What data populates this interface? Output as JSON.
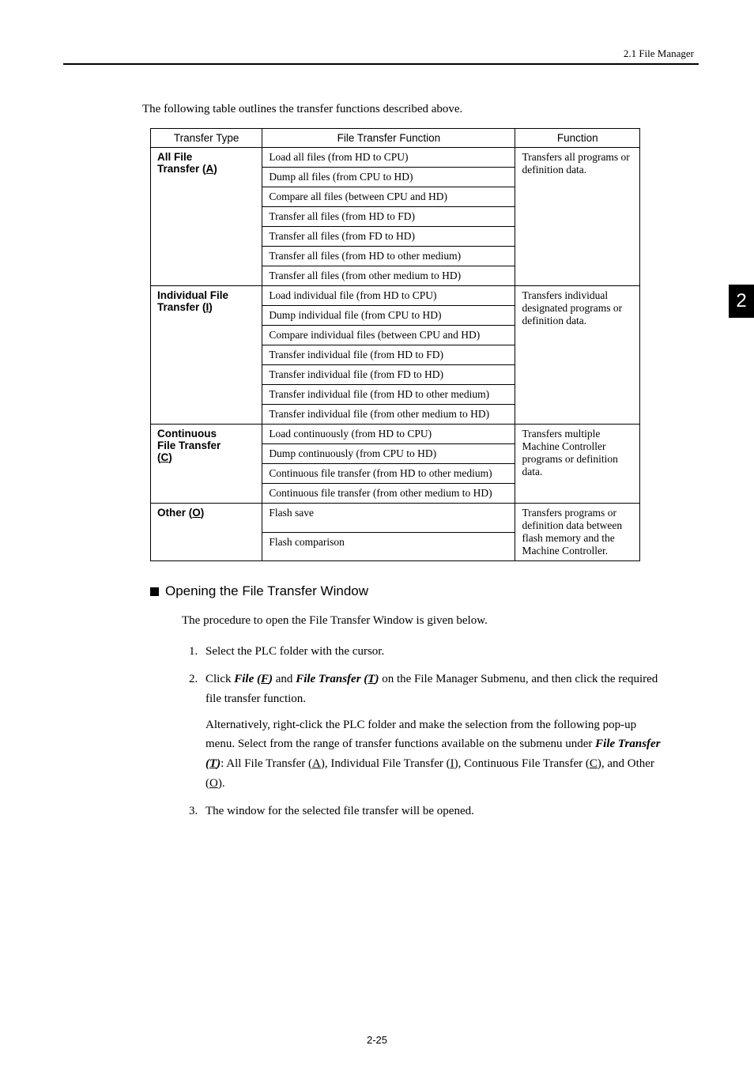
{
  "header": {
    "right_label": "2.1  File Manager"
  },
  "side_tab": "2",
  "intro": "The following table outlines the transfer functions described above.",
  "table": {
    "headers": [
      "Transfer Type",
      "File Transfer Function",
      "Function"
    ],
    "groups": [
      {
        "type_prefix": "All File",
        "type_line2a": "Transfer (",
        "type_line2b": "A",
        "type_line2c": ")",
        "desc": "Transfers all programs or definition data.",
        "rows": [
          "Load all files (from HD to CPU)",
          "Dump all files (from CPU to HD)",
          "Compare all files (between CPU and HD)",
          "Transfer all files (from HD to FD)",
          "Transfer all files (from FD to HD)",
          "Transfer all files (from HD to other medium)",
          "Transfer all files (from other medium to HD)"
        ]
      },
      {
        "type_prefix": "Individual File",
        "type_line2a": "Transfer (",
        "type_line2b": "I",
        "type_line2c": ")",
        "desc": "Transfers individual designated programs or definition data.",
        "rows": [
          "Load individual file (from HD to CPU)",
          "Dump individual file (from CPU to HD)",
          "Compare individual files (between CPU and HD)",
          "Transfer individual file (from HD to FD)",
          "Transfer individual file (from FD to HD)",
          "Transfer individual file (from HD to other medium)",
          "Transfer individual file (from other medium to HD)"
        ]
      },
      {
        "type_prefix": "Continuous",
        "type_line2a": "File Transfer",
        "type_line3a": "(",
        "type_line3b": "C",
        "type_line3c": ")",
        "desc": "Transfers multiple Machine Controller programs or definition data.",
        "rows": [
          "Load continuously (from HD to CPU)",
          "Dump continuously (from CPU to HD)",
          "Continuous file transfer (from HD to other medium)",
          "Continuous file transfer (from other medium to HD)"
        ]
      },
      {
        "type_prefix_a": "Other (",
        "type_prefix_b": "O",
        "type_prefix_c": ")",
        "desc": "Transfers programs or definition data between flash memory and the Machine Controller.",
        "rows": [
          "Flash save",
          "Flash comparison"
        ]
      }
    ]
  },
  "section_heading": "Opening the File Transfer Window",
  "body_intro": "The procedure to open the File Transfer Window is given below.",
  "steps": {
    "s1": "Select the PLC folder with the cursor.",
    "s2a": "Click ",
    "s2_file": "File (",
    "s2_fileU": "F",
    "s2_file_end": ")",
    "s2_and": " and ",
    "s2_ft": "File Transfer (",
    "s2_ftU": "T",
    "s2_ft_end": ")",
    "s2b": " on the File Manager Submenu, and then click the required file transfer function.",
    "s2_sub1": "Alternatively, right-click the PLC folder and make the selection from the following pop-up menu. Select from the range of transfer functions available on the submenu under ",
    "s2_sub_ft": "File Transfer (",
    "s2_sub_ftU": "T",
    "s2_sub_ft_end": ")",
    "s2_sub2": ": All File Transfer (",
    "s2_subA": "A",
    "s2_sub3": "), Individual File Transfer (",
    "s2_subI": "I",
    "s2_sub4": "), Continuous File Transfer (",
    "s2_subC": "C",
    "s2_sub5": "), and Other (",
    "s2_subO": "O",
    "s2_sub6": ").",
    "s3": "The window for the selected file transfer will be opened."
  },
  "page_number": "2-25"
}
